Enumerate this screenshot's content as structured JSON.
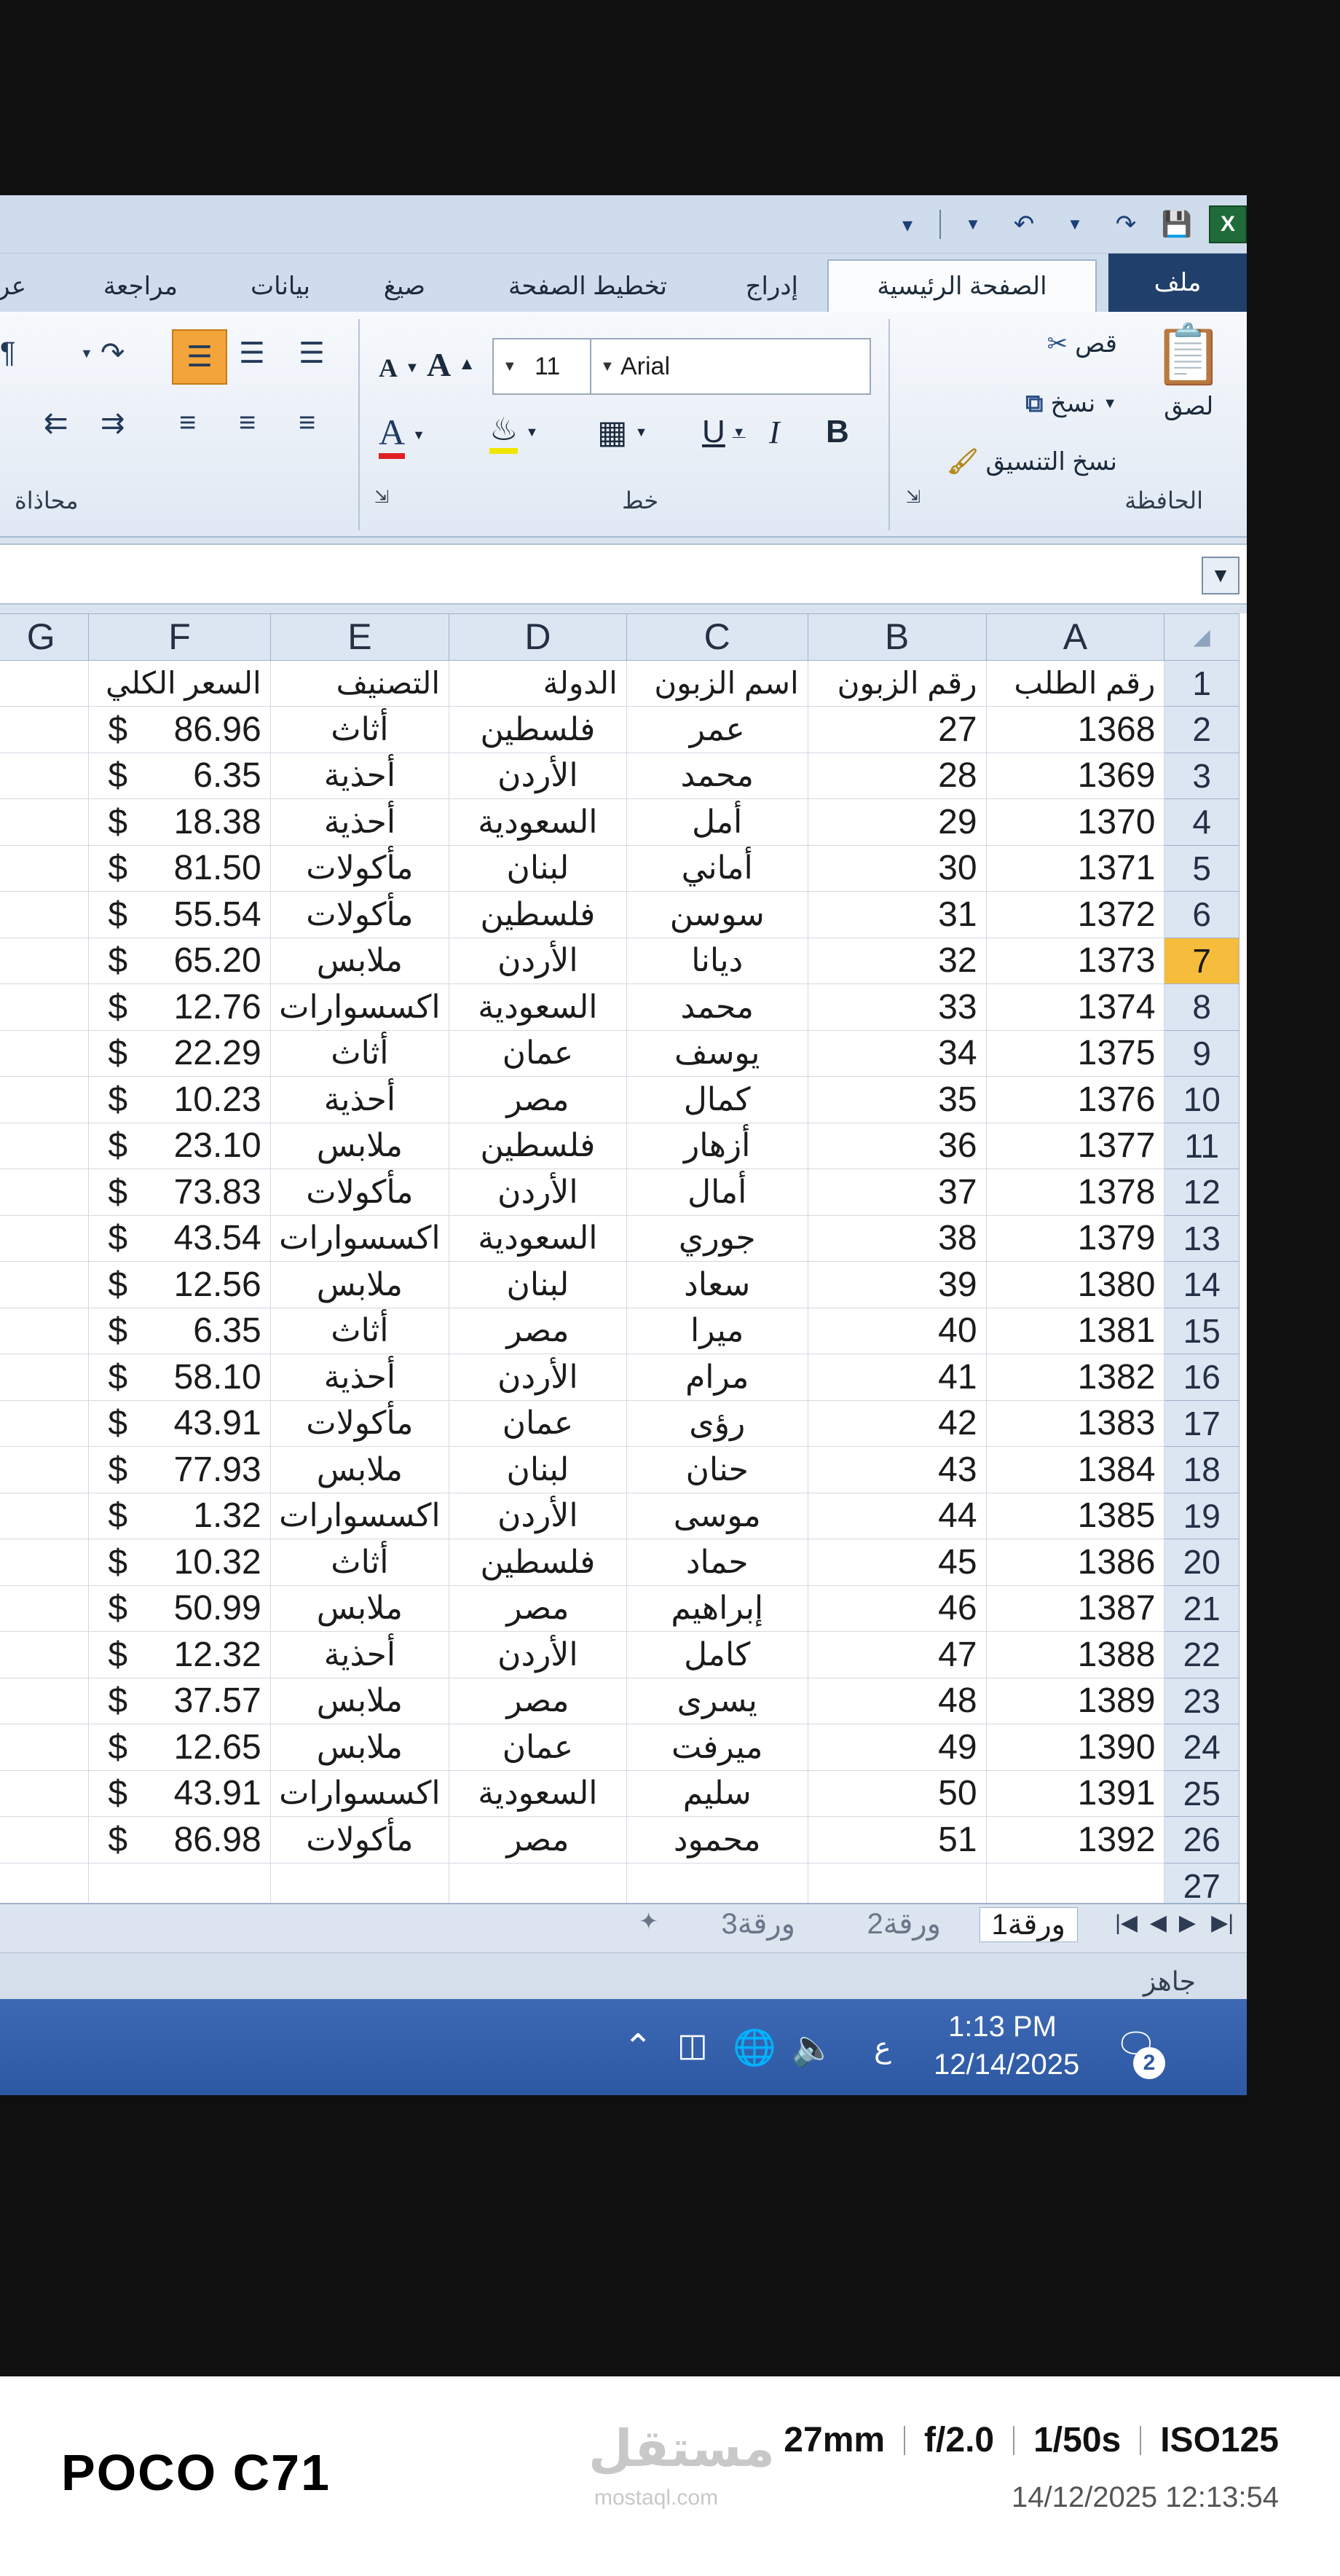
{
  "qat": {
    "excel_icon_letter": "X"
  },
  "tabs": [
    "ملف",
    "الصفحة الرئيسية",
    "إدراج",
    "تخطيط الصفحة",
    "صيغ",
    "بيانات",
    "مراجعة",
    "عر"
  ],
  "ribbon": {
    "clipboard": {
      "paste": "لصق",
      "cut": "قص",
      "copy": "نسخ",
      "format_painter": "نسخ التنسيق",
      "label": "الحافظة"
    },
    "font": {
      "font_name": "Arial",
      "font_size": "11",
      "bold": "B",
      "italic": "I",
      "underline": "U",
      "font_color_letter": "A",
      "grow": "A",
      "shrink": "A",
      "label": "خط"
    },
    "alignment": {
      "label": "محاذاة"
    }
  },
  "columns": [
    "A",
    "B",
    "C",
    "D",
    "E",
    "F",
    "G"
  ],
  "selected_row": "7",
  "headers": [
    "رقم الطلب",
    "رقم الزبون",
    "اسم الزبون",
    "الدولة",
    "التصنيف",
    "السعر الكلي"
  ],
  "rows": [
    {
      "n": "2",
      "order": "1368",
      "cust": "27",
      "name": "عمر",
      "country": "فلسطين",
      "cat": "أثاث",
      "cur": "$",
      "price": "86.96"
    },
    {
      "n": "3",
      "order": "1369",
      "cust": "28",
      "name": "محمد",
      "country": "الأردن",
      "cat": "أحذية",
      "cur": "$",
      "price": "6.35"
    },
    {
      "n": "4",
      "order": "1370",
      "cust": "29",
      "name": "أمل",
      "country": "السعودية",
      "cat": "أحذية",
      "cur": "$",
      "price": "18.38"
    },
    {
      "n": "5",
      "order": "1371",
      "cust": "30",
      "name": "أماني",
      "country": "لبنان",
      "cat": "مأكولات",
      "cur": "$",
      "price": "81.50"
    },
    {
      "n": "6",
      "order": "1372",
      "cust": "31",
      "name": "سوسن",
      "country": "فلسطين",
      "cat": "مأكولات",
      "cur": "$",
      "price": "55.54"
    },
    {
      "n": "7",
      "order": "1373",
      "cust": "32",
      "name": "ديانا",
      "country": "الأردن",
      "cat": "ملابس",
      "cur": "$",
      "price": "65.20"
    },
    {
      "n": "8",
      "order": "1374",
      "cust": "33",
      "name": "محمد",
      "country": "السعودية",
      "cat": "اكسسوارات",
      "cur": "$",
      "price": "12.76"
    },
    {
      "n": "9",
      "order": "1375",
      "cust": "34",
      "name": "يوسف",
      "country": "عمان",
      "cat": "أثاث",
      "cur": "$",
      "price": "22.29"
    },
    {
      "n": "10",
      "order": "1376",
      "cust": "35",
      "name": "كمال",
      "country": "مصر",
      "cat": "أحذية",
      "cur": "$",
      "price": "10.23"
    },
    {
      "n": "11",
      "order": "1377",
      "cust": "36",
      "name": "أزهار",
      "country": "فلسطين",
      "cat": "ملابس",
      "cur": "$",
      "price": "23.10"
    },
    {
      "n": "12",
      "order": "1378",
      "cust": "37",
      "name": "أمال",
      "country": "الأردن",
      "cat": "مأكولات",
      "cur": "$",
      "price": "73.83"
    },
    {
      "n": "13",
      "order": "1379",
      "cust": "38",
      "name": "جوري",
      "country": "السعودية",
      "cat": "اكسسوارات",
      "cur": "$",
      "price": "43.54"
    },
    {
      "n": "14",
      "order": "1380",
      "cust": "39",
      "name": "سعاد",
      "country": "لبنان",
      "cat": "ملابس",
      "cur": "$",
      "price": "12.56"
    },
    {
      "n": "15",
      "order": "1381",
      "cust": "40",
      "name": "ميرا",
      "country": "مصر",
      "cat": "أثاث",
      "cur": "$",
      "price": "6.35"
    },
    {
      "n": "16",
      "order": "1382",
      "cust": "41",
      "name": "مرام",
      "country": "الأردن",
      "cat": "أحذية",
      "cur": "$",
      "price": "58.10"
    },
    {
      "n": "17",
      "order": "1383",
      "cust": "42",
      "name": "رؤى",
      "country": "عمان",
      "cat": "مأكولات",
      "cur": "$",
      "price": "43.91"
    },
    {
      "n": "18",
      "order": "1384",
      "cust": "43",
      "name": "حنان",
      "country": "لبنان",
      "cat": "ملابس",
      "cur": "$",
      "price": "77.93"
    },
    {
      "n": "19",
      "order": "1385",
      "cust": "44",
      "name": "موسى",
      "country": "الأردن",
      "cat": "اكسسوارات",
      "cur": "$",
      "price": "1.32"
    },
    {
      "n": "20",
      "order": "1386",
      "cust": "45",
      "name": "حماد",
      "country": "فلسطين",
      "cat": "أثاث",
      "cur": "$",
      "price": "10.32"
    },
    {
      "n": "21",
      "order": "1387",
      "cust": "46",
      "name": "إبراهيم",
      "country": "مصر",
      "cat": "ملابس",
      "cur": "$",
      "price": "50.99"
    },
    {
      "n": "22",
      "order": "1388",
      "cust": "47",
      "name": "كامل",
      "country": "الأردن",
      "cat": "أحذية",
      "cur": "$",
      "price": "12.32"
    },
    {
      "n": "23",
      "order": "1389",
      "cust": "48",
      "name": "يسرى",
      "country": "مصر",
      "cat": "ملابس",
      "cur": "$",
      "price": "37.57"
    },
    {
      "n": "24",
      "order": "1390",
      "cust": "49",
      "name": "ميرفت",
      "country": "عمان",
      "cat": "ملابس",
      "cur": "$",
      "price": "12.65"
    },
    {
      "n": "25",
      "order": "1391",
      "cust": "50",
      "name": "سليم",
      "country": "السعودية",
      "cat": "اكسسوارات",
      "cur": "$",
      "price": "43.91"
    },
    {
      "n": "26",
      "order": "1392",
      "cust": "51",
      "name": "محمود",
      "country": "مصر",
      "cat": "مأكولات",
      "cur": "$",
      "price": "86.98"
    }
  ],
  "last_row_number": "27",
  "sheets": [
    "ورقة1",
    "ورقة2",
    "ورقة3"
  ],
  "status": "جاهز",
  "taskbar": {
    "time": "1:13 PM",
    "date": "12/14/2025",
    "lang": "ع",
    "notifications": "2"
  },
  "footer": {
    "camera": "POCO C71",
    "exif": [
      "27mm",
      "f/2.0",
      "1/50s",
      "ISO125"
    ],
    "datetime": "14/12/2025 12:13:54",
    "watermark": "مستقل",
    "watermark_sub": "mostaql.com"
  }
}
